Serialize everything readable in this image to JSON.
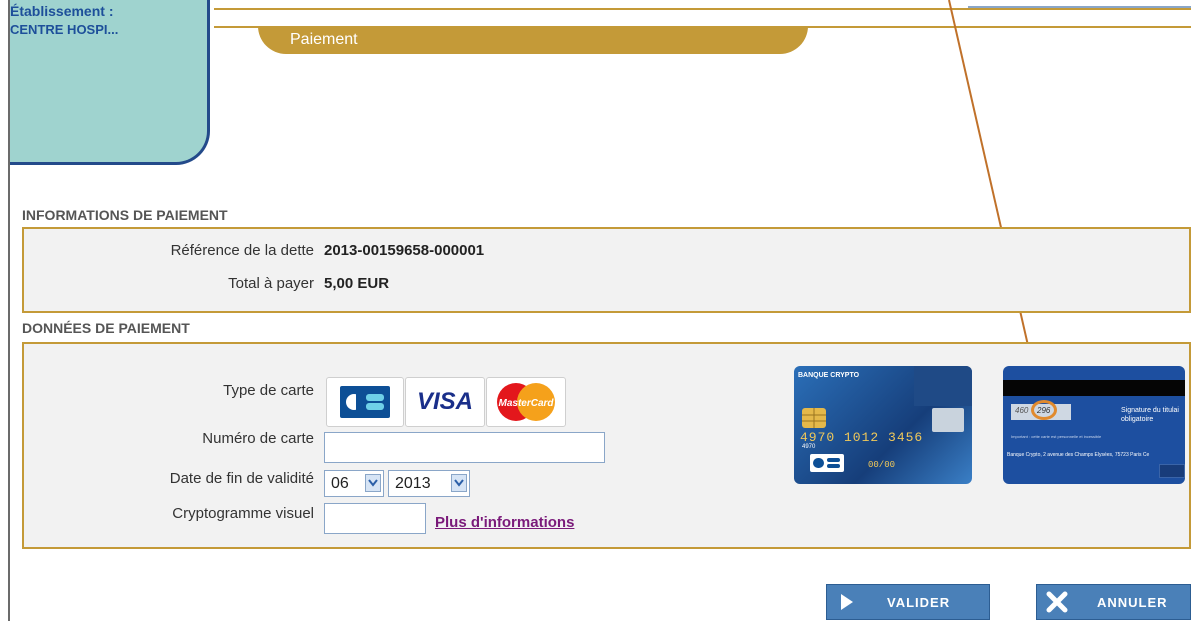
{
  "header": {
    "etablissement_label": "Établissement :",
    "etablissement_value": "CENTRE HOSPI...",
    "tab_title": "Paiement"
  },
  "info_section": {
    "title": "INFORMATIONS DE PAIEMENT",
    "reference_label": "Référence de la dette",
    "reference_value": "2013-00159658-000001",
    "total_label": "Total à payer",
    "total_value": "5,00 EUR"
  },
  "payment_section": {
    "title": "DONNÉES DE PAIEMENT",
    "card_type_label": "Type de carte",
    "card_types": [
      "CB",
      "VISA",
      "MasterCard"
    ],
    "card_number_label": "Numéro de carte",
    "card_number_value": "",
    "expiry_label": "Date de fin de validité",
    "expiry_month": "06",
    "expiry_year": "2013",
    "cvv_label": "Cryptogramme visuel",
    "cvv_value": "",
    "more_info_link": "Plus d'informations"
  },
  "card_front": {
    "bank_name": "BANQUE CRYPTO",
    "number": "4970 1012 3456",
    "number_small": "4970",
    "expiry": "00/00"
  },
  "card_back": {
    "digits1": "460",
    "digits2": "296",
    "signature_text": "Signature du titulai obligatoire",
    "important_text": "Important : cette carte est personnelle et incessible",
    "address_text": "Banque Crypto, 2 avenue des Champs Elysées, 75723 Paris Ce"
  },
  "buttons": {
    "validate": "VALIDER",
    "cancel": "ANNULER"
  },
  "colors": {
    "accent_gold": "#c49a38",
    "teal_box": "#9fd3cf",
    "button_blue": "#4a80b8",
    "link_purple": "#7a1a7a"
  }
}
